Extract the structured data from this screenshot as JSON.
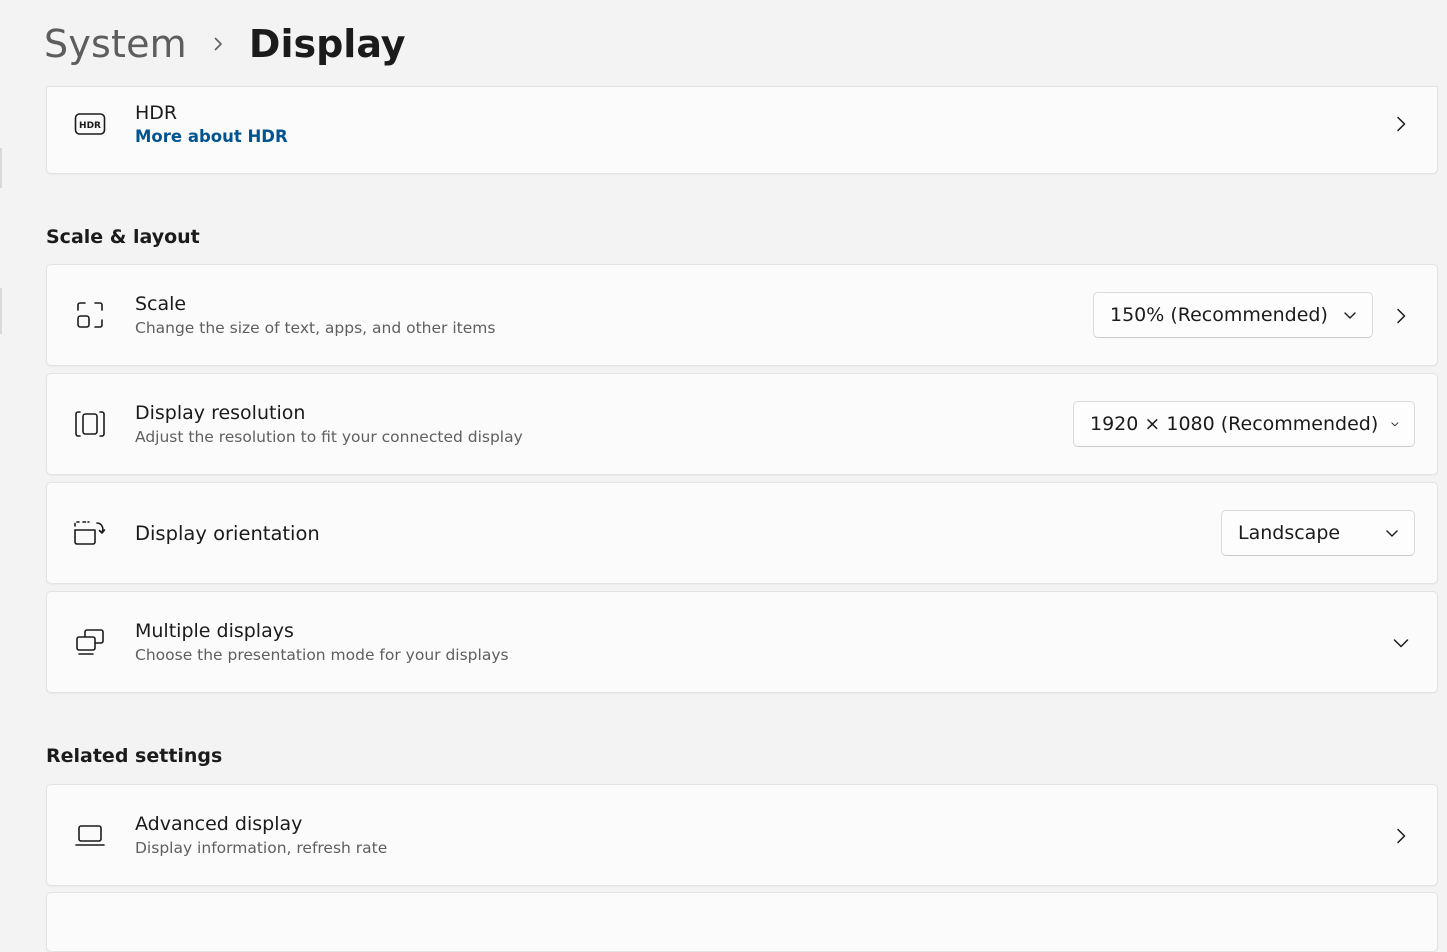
{
  "breadcrumb": {
    "parent": "System",
    "current": "Display"
  },
  "hdr": {
    "title": "HDR",
    "link": "More about HDR",
    "icon": "hdr-icon"
  },
  "scale_layout": {
    "header": "Scale & layout",
    "scale": {
      "title": "Scale",
      "subtitle": "Change the size of text, apps, and other items",
      "value": "150% (Recommended)",
      "icon": "scale-icon"
    },
    "resolution": {
      "title": "Display resolution",
      "subtitle": "Adjust the resolution to fit your connected display",
      "value": "1920 × 1080 (Recommended)",
      "icon": "resolution-icon"
    },
    "orientation": {
      "title": "Display orientation",
      "value": "Landscape",
      "icon": "orientation-icon"
    },
    "multiple": {
      "title": "Multiple displays",
      "subtitle": "Choose the presentation mode for your displays",
      "icon": "multiple-displays-icon"
    }
  },
  "related": {
    "header": "Related settings",
    "advanced": {
      "title": "Advanced display",
      "subtitle": "Display information, refresh rate",
      "icon": "laptop-icon"
    }
  },
  "colors": {
    "background": "#f3f3f3",
    "card": "#fbfbfb",
    "link": "#00548f"
  }
}
